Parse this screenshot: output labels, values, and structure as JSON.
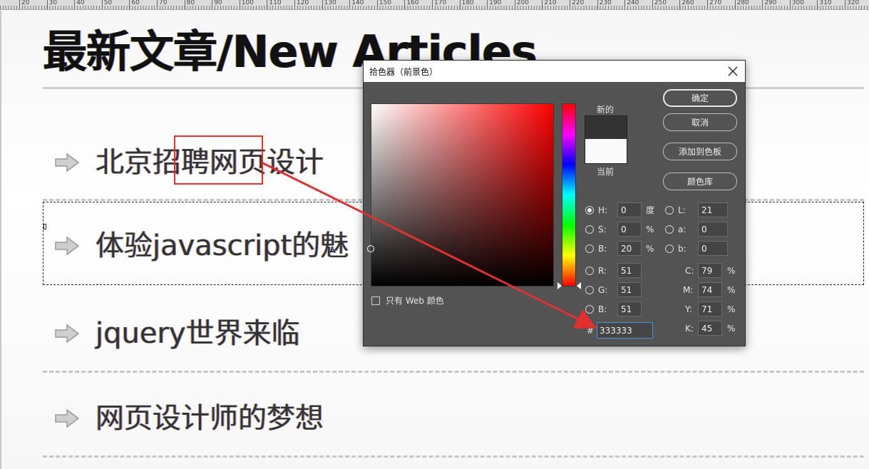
{
  "ruler": {
    "labels": [
      "20",
      "30",
      "40",
      "50",
      "60",
      "70",
      "80",
      "90",
      "100",
      "110",
      "120",
      "130",
      "140",
      "150",
      "160",
      "170",
      "180",
      "190",
      "200",
      "210",
      "220",
      "230",
      "240",
      "250",
      "260",
      "270",
      "280",
      "290",
      "300",
      "310",
      "320"
    ]
  },
  "page": {
    "title": "最新文章/New Articles",
    "articles": [
      {
        "text": "北京招聘网页设计",
        "icon": "arrow-right-icon"
      },
      {
        "text": "体验javascript的魅",
        "icon": "arrow-right-icon"
      },
      {
        "text": "jquery世界来临",
        "icon": "arrow-right-icon"
      },
      {
        "text": "网页设计师的梦想",
        "icon": "arrow-right-icon"
      }
    ]
  },
  "dialog": {
    "title": "拾色器（前景色）",
    "close_icon": "close-icon",
    "new_label": "新的",
    "current_label": "当前",
    "new_color": "#333333",
    "current_color": "#fafafa",
    "buttons": {
      "ok": "确定",
      "cancel": "取消",
      "add_swatch": "添加到色板",
      "color_libraries": "颜色库"
    },
    "hsb": {
      "h_label": "H:",
      "h_value": "0",
      "h_unit": "度",
      "s_label": "S:",
      "s_value": "0",
      "s_unit": "%",
      "b_label": "B:",
      "b_value": "20",
      "b_unit": "%"
    },
    "rgb": {
      "r_label": "R:",
      "r_value": "51",
      "g_label": "G:",
      "g_value": "51",
      "b_label": "B:",
      "b_value": "51"
    },
    "lab": {
      "l_label": "L:",
      "l_value": "21",
      "a_label": "a:",
      "a_value": "0",
      "b_label": "b:",
      "b_value": "0"
    },
    "cmyk": {
      "c_label": "C:",
      "c_value": "79",
      "c_unit": "%",
      "m_label": "M:",
      "m_value": "74",
      "m_unit": "%",
      "y_label": "Y:",
      "y_value": "71",
      "y_unit": "%",
      "k_label": "K:",
      "k_value": "45",
      "k_unit": "%"
    },
    "hex_label": "#",
    "hex_value": "333333",
    "web_only_label": "只有 Web 颜色",
    "selected_mode": "H"
  },
  "annotation": {
    "color": "#e23030"
  }
}
